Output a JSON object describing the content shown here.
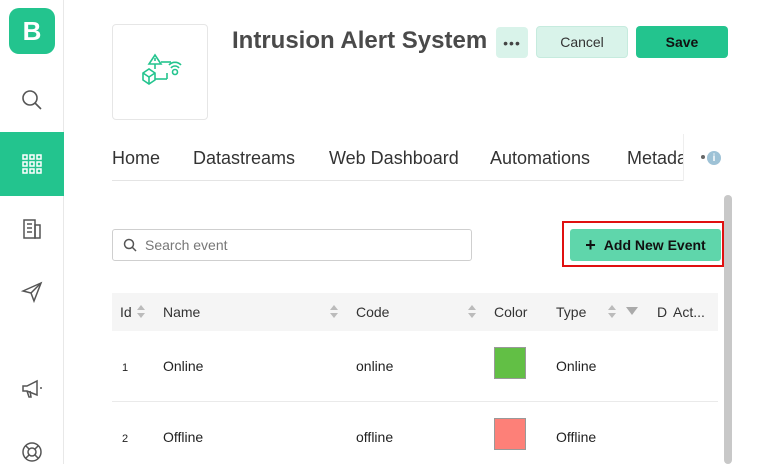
{
  "app": {
    "logo_letter": "B"
  },
  "sidebar": {
    "items": [
      {
        "icon": "search-icon",
        "active": false
      },
      {
        "icon": "grid-icon",
        "active": true
      },
      {
        "icon": "building-icon",
        "active": false
      },
      {
        "icon": "send-icon",
        "active": false
      },
      {
        "icon": "megaphone-icon",
        "active": false
      },
      {
        "icon": "lifebuoy-icon",
        "active": false
      }
    ]
  },
  "header": {
    "title": "Intrusion Alert System",
    "more_label": "•••",
    "cancel_label": "Cancel",
    "save_label": "Save"
  },
  "tabs": [
    "Home",
    "Datastreams",
    "Web Dashboard",
    "Automations",
    "Metadata"
  ],
  "toolbar": {
    "search_placeholder": "Search event",
    "add_plus": "+",
    "add_label": "Add New Event"
  },
  "table": {
    "columns": [
      "Id",
      "Name",
      "Code",
      "Color",
      "Type",
      "D",
      "Act..."
    ],
    "rows": [
      {
        "id": "1",
        "name": "Online",
        "code": "online",
        "color": "#62bf45",
        "type": "Online"
      },
      {
        "id": "2",
        "name": "Offline",
        "code": "offline",
        "color": "#fd8078",
        "type": "Offline"
      }
    ]
  },
  "colors": {
    "accent": "#23c48e",
    "accent_light": "#d9f3ea",
    "highlight": "#e01010"
  }
}
